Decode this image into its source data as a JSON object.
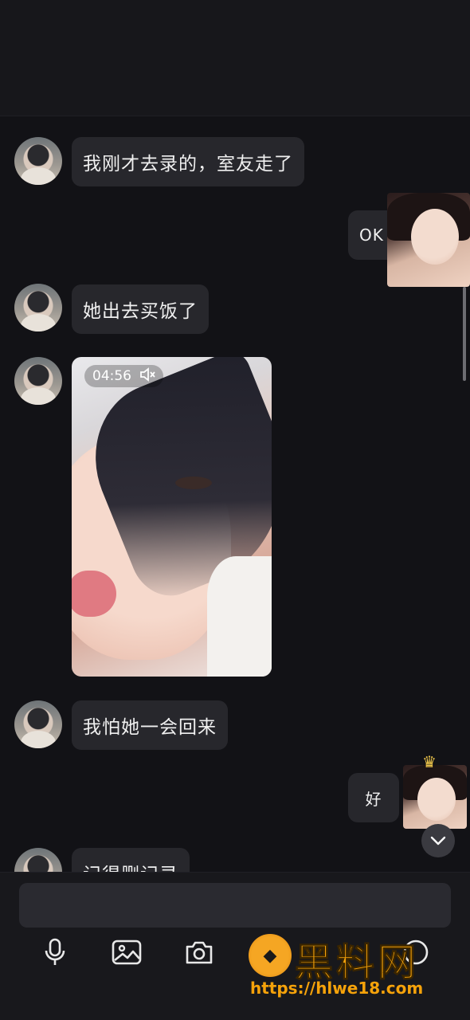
{
  "messages": [
    {
      "side": "left",
      "type": "text",
      "text": "我刚才去录的，室友走了"
    },
    {
      "side": "right",
      "type": "text",
      "text": "OK"
    },
    {
      "side": "left",
      "type": "text",
      "text": "她出去买饭了"
    },
    {
      "side": "left",
      "type": "video",
      "duration": "04:56",
      "muted": true
    },
    {
      "side": "left",
      "type": "text",
      "text": "我怕她一会回来"
    },
    {
      "side": "right",
      "type": "text",
      "text": "好"
    },
    {
      "side": "left",
      "type": "text",
      "text": "记得删记录"
    }
  ],
  "input": {
    "placeholder": "",
    "value": ""
  },
  "toolbar": [
    "microphone-icon",
    "image-icon",
    "camera-icon",
    "emoji-icon",
    "more-icon"
  ],
  "watermark": {
    "title": "黑料网",
    "url": "https://hlwe18.com"
  },
  "colors": {
    "background": "#121216",
    "bubble": "#27272c",
    "accent": "#f5a20a"
  }
}
